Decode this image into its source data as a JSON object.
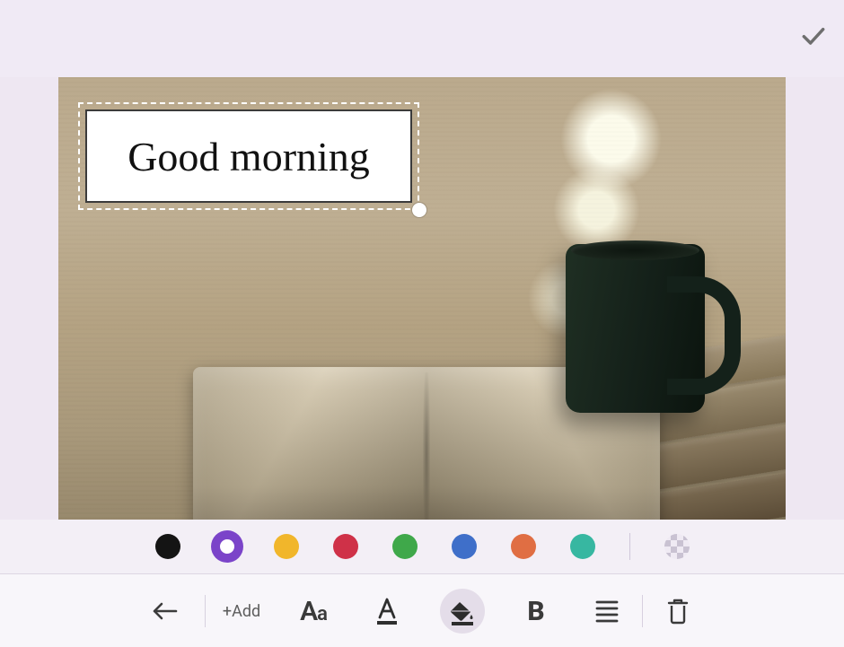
{
  "header": {
    "confirm_label": "Done"
  },
  "canvas": {
    "text_value": "Good morning"
  },
  "swatches": {
    "colors": [
      {
        "name": "black",
        "hex": "#141414",
        "selected": false
      },
      {
        "name": "purple",
        "hex": "#7b44c9",
        "selected": true
      },
      {
        "name": "amber",
        "hex": "#f1b62b",
        "selected": false
      },
      {
        "name": "red",
        "hex": "#cf3148",
        "selected": false
      },
      {
        "name": "green",
        "hex": "#3fa84a",
        "selected": false
      },
      {
        "name": "blue",
        "hex": "#3f6fc9",
        "selected": false
      },
      {
        "name": "orange",
        "hex": "#e06e43",
        "selected": false
      },
      {
        "name": "teal",
        "hex": "#37b7a1",
        "selected": false
      }
    ],
    "transparent_label": "no-fill"
  },
  "toolbar": {
    "back_label": "Back",
    "add_label": "+Add",
    "font_label": "Aa",
    "text_color_label": "A",
    "fill_color_label": "Fill",
    "bold_label": "B",
    "align_label": "Align",
    "delete_label": "Delete"
  }
}
